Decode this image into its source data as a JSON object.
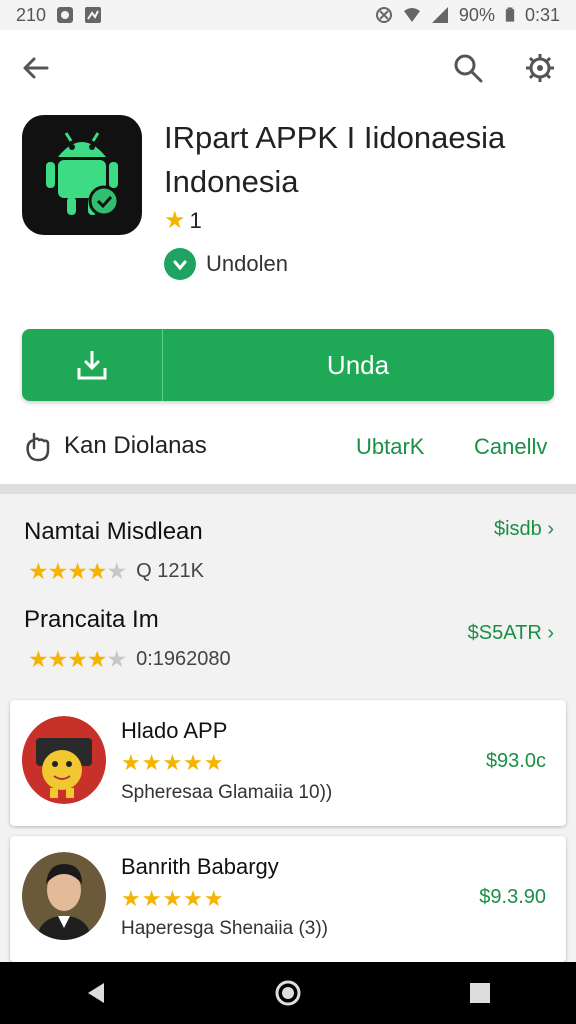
{
  "status_bar": {
    "time_left": "210",
    "battery": "90%",
    "time_right": "0:31"
  },
  "app": {
    "title": "IRpart APPK I Iidonaesia Indonesia",
    "rating": "1",
    "installed_label": "Undolen"
  },
  "main_button": {
    "label": "Unda"
  },
  "action_row": {
    "left_label": "Kan Diolanas",
    "link1": "UbtarK",
    "link2": "Canellv"
  },
  "recommendations": [
    {
      "name": "Namtai Misdlean",
      "price": "$isdb",
      "rating": 4.5,
      "reviews": "Q 121K"
    },
    {
      "name": "Prancaita Im",
      "price": "$S5ATR",
      "rating": 4.5,
      "reviews": "0:1962080"
    }
  ],
  "cards": [
    {
      "name": "Hlado APP",
      "subtitle": "Spheresaa Glamaiia 10))",
      "price": "$93.0c",
      "stars": "★★★★★"
    },
    {
      "name": "Banrith Babargy",
      "subtitle": "Haperesga Shenaiia (3))",
      "price": "$9.3.90",
      "stars": "★★★★★"
    }
  ],
  "colors": {
    "primary_green": "#1fa855",
    "link_green": "#1a8f46",
    "star": "#f4b400"
  }
}
